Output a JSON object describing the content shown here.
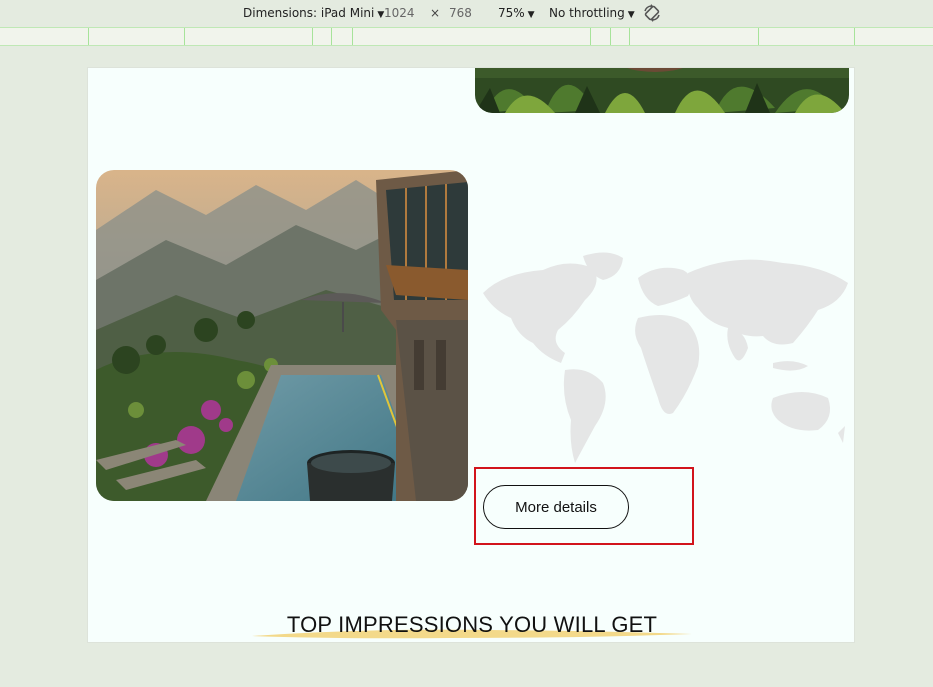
{
  "devtools": {
    "dimensions_label": "Dimensions: iPad Mini",
    "width": "1024",
    "times": "×",
    "height": "768",
    "zoom": "75%",
    "throttling": "No throttling",
    "rotate_icon": "rotate-icon",
    "dropdown_icon": "chevron-down-icon"
  },
  "page": {
    "more_details_label": "More details",
    "section_title": "TOP IMPRESSIONS YOU WILL GET",
    "highlight_color": "#d2141c",
    "underline_color": "#f3d98a",
    "map_color": "#e5e6e6"
  }
}
